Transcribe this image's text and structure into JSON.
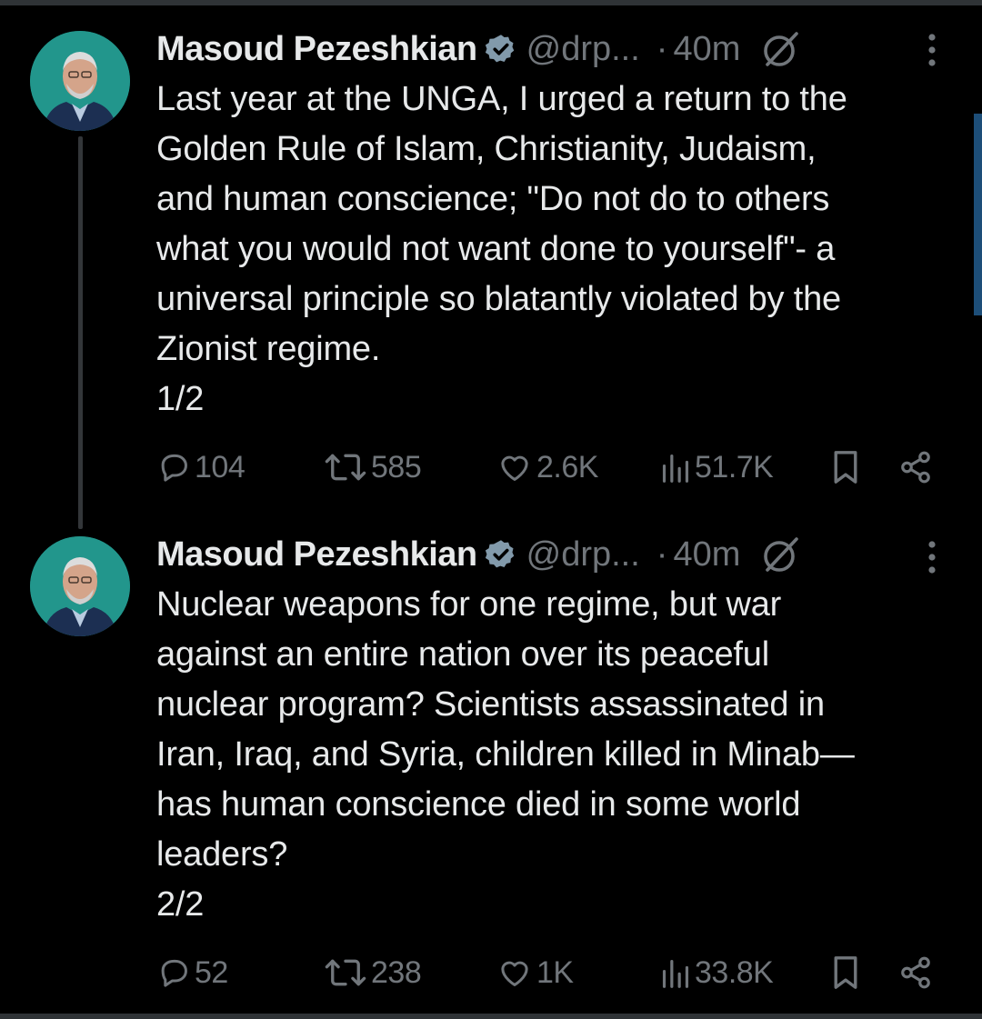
{
  "colors": {
    "background": "#000000",
    "text_primary": "#e7e9ea",
    "text_secondary": "#71767b",
    "verified_badge": "#829aab",
    "thread_line": "#333639",
    "scroll_accent": "#1d4e78"
  },
  "tweets": [
    {
      "author": {
        "name": "Masoud Pezeshkian",
        "handle": "@drp...",
        "verified_icon": "verified-badge-icon",
        "avatar_icon": "avatar"
      },
      "dot": "·",
      "time": "40m",
      "text": "Last year at the UNGA, I urged a return to the\nGolden Rule of Islam, Christianity, Judaism,\nand human conscience; \"Do not do to others\nwhat you would not want done to yourself\"- a\nuniversal principle so blatantly violated by the\nZionist regime.\n 1/2",
      "stats": {
        "replies": "104",
        "reposts": "585",
        "likes": "2.6K",
        "views": "51.7K"
      }
    },
    {
      "author": {
        "name": "Masoud Pezeshkian",
        "handle": "@drp...",
        "verified_icon": "verified-badge-icon",
        "avatar_icon": "avatar"
      },
      "dot": "·",
      "time": "40m",
      "text": "Nuclear weapons for one regime, but war\nagainst an entire nation over its peaceful\nnuclear program? Scientists assassinated in\nIran, Iraq, and Syria, children killed in Minab—\nhas human conscience died in some world\nleaders?\n2/2",
      "stats": {
        "replies": "52",
        "reposts": "238",
        "likes": "1K",
        "views": "33.8K"
      }
    }
  ],
  "icons": {
    "reply": "reply-icon",
    "repost": "repost-icon",
    "like": "like-icon",
    "views": "views-icon",
    "bookmark": "bookmark-icon",
    "share": "share-icon",
    "grok": "grok-icon",
    "more": "more-icon"
  }
}
